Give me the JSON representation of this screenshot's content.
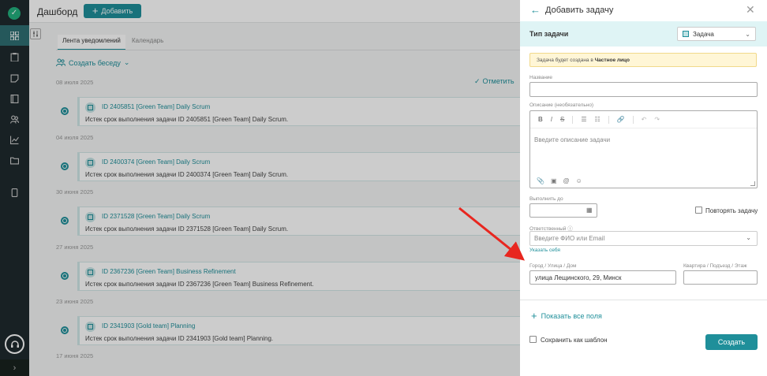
{
  "app": {
    "logo_glyph": "✓"
  },
  "rail": {
    "items": [
      "dashboard-icon",
      "clipboard-icon",
      "note-icon",
      "book-icon",
      "users-icon",
      "chart-icon",
      "folder-icon",
      "phone-icon"
    ]
  },
  "topbar": {
    "title": "Дашборд",
    "add_label": "Добавить",
    "add_plus": "+"
  },
  "tabs": [
    "Лента уведомлений",
    "Календарь"
  ],
  "conversation": {
    "label": "Создать беседу",
    "chevron": "⌄"
  },
  "mark_all": {
    "label": "Отметить"
  },
  "feed": [
    {
      "date": "08 июля 2025",
      "title": "ID 2405851 [Green Team] Daily Scrum",
      "body": "Истек срок выполнения задачи ID 2405851 [Green Team] Daily Scrum."
    },
    {
      "date": "04 июля 2025",
      "title": "ID 2400374 [Green Team] Daily Scrum",
      "body": "Истек срок выполнения задачи ID 2400374 [Green Team] Daily Scrum."
    },
    {
      "date": "30 июня 2025",
      "title": "ID 2371528 [Green Team] Daily Scrum",
      "body": "Истек срок выполнения задачи ID 2371528 [Green Team] Daily Scrum."
    },
    {
      "date": "27 июня 2025",
      "title": "ID 2367236 [Green Team] Business Refinement",
      "body": "Истек срок выполнения задачи ID 2367236 [Green Team] Business Refinement."
    },
    {
      "date": "23 июня 2025",
      "title": "ID 2341903 [Gold team] Planning",
      "body": "Истек срок выполнения задачи ID 2341903 [Gold team] Planning."
    }
  ],
  "feed_last_date": "17 июня 2025",
  "panel": {
    "back": "←",
    "title": "Добавить задачу",
    "close": "✕",
    "type_label": "Тип задачи",
    "type_value": "Задача",
    "type_dd": "⌄",
    "warning_prefix": "Задача будет создана в ",
    "warning_target": "Частное лицо",
    "name_label": "Название",
    "name_value": "",
    "desc_label": "Описание (необязательно)",
    "desc_placeholder": "Введите описание задачи",
    "toolbar": [
      "B",
      "I",
      "S",
      "☰",
      "☷",
      "🔗",
      "↶",
      "↷"
    ],
    "editor_bottom": [
      "📎",
      "▣",
      "@",
      "☺"
    ],
    "due_label": "Выполнить до",
    "due_value": "",
    "due_icon": "▦",
    "repeat_label": "Повторять задачу",
    "assignee_label": "Ответственный",
    "assignee_info": "ⓘ",
    "assignee_placeholder": "Введите ФИО или Email",
    "assignee_dd": "⌄",
    "assign_self": "Указать себя",
    "address_label": "Город / Улица / Дом",
    "address_value": "улица Лещинского, 29, Минск",
    "apt_label": "Квартира / Подъезд / Этаж",
    "apt_value": "",
    "show_all": "Показать все поля",
    "show_all_plus": "+",
    "save_template": "Сохранить как шаблон",
    "create": "Создать"
  },
  "colors": {
    "accent": "#1f8f9a",
    "rail": "#1e2a2d",
    "arrow": "#e8261f"
  }
}
